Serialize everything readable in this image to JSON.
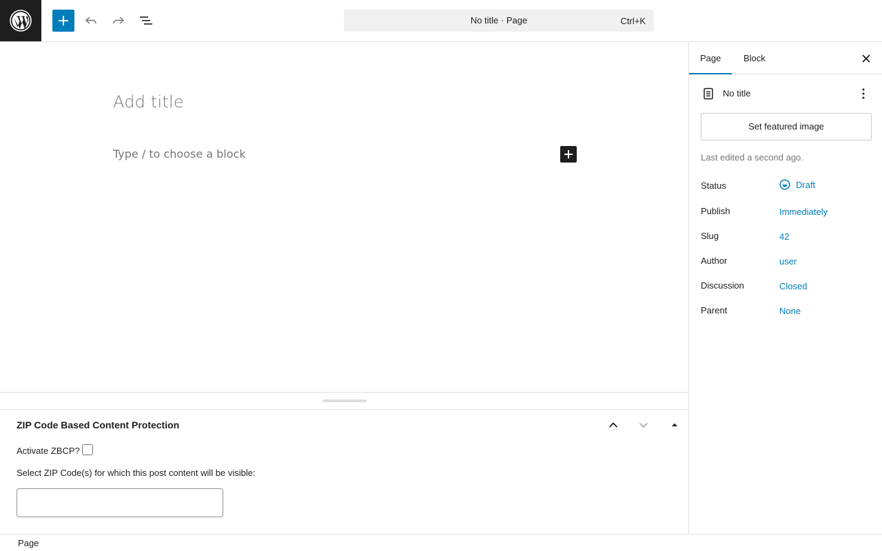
{
  "toolbar": {
    "logo_icon": "wordpress-logo",
    "add_block_icon": "plus-icon",
    "undo_icon": "undo-icon",
    "redo_icon": "redo-icon",
    "document_overview_icon": "list-view-icon",
    "command_bar": {
      "title": "No title · Page",
      "shortcut": "Ctrl+K"
    }
  },
  "editor": {
    "title_placeholder": "Add title",
    "block_placeholder": "Type / to choose a block"
  },
  "metabox": {
    "title": "ZIP Code Based Content Protection",
    "activate_label": "Activate ZBCP?",
    "activate_checked": false,
    "zip_label": "Select ZIP Code(s) for which this post content will be visible:",
    "zip_value": ""
  },
  "footer": {
    "breadcrumb": "Page"
  },
  "sidebar": {
    "tabs": [
      {
        "label": "Page",
        "active": true
      },
      {
        "label": "Block",
        "active": false
      }
    ],
    "document": {
      "title": "No title"
    },
    "featured_image_label": "Set featured image",
    "last_edited": "Last edited a second ago.",
    "rows": [
      {
        "key": "Status",
        "value": "Draft"
      },
      {
        "key": "Publish",
        "value": "Immediately"
      },
      {
        "key": "Slug",
        "value": "42"
      },
      {
        "key": "Author",
        "value": "user"
      },
      {
        "key": "Discussion",
        "value": "Closed"
      },
      {
        "key": "Parent",
        "value": "None"
      }
    ]
  },
  "colors": {
    "accent": "#007cba",
    "dark": "#1e1e1e",
    "muted": "#757575",
    "border": "#e0e0e0"
  }
}
